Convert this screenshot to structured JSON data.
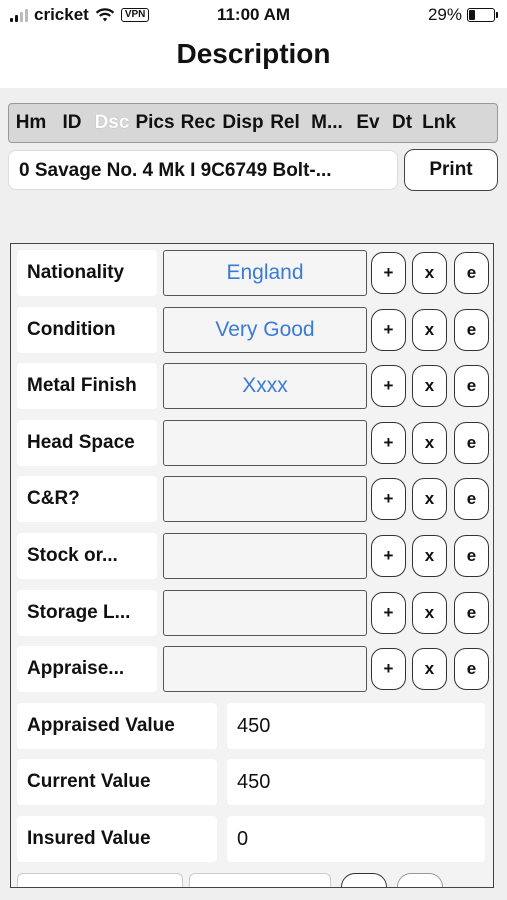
{
  "status": {
    "carrier": "cricket",
    "vpn": "VPN",
    "time": "11:00 AM",
    "battery": "29%",
    "battery_level": 0.29
  },
  "title": "Description",
  "tabs": [
    {
      "label": "Hm"
    },
    {
      "label": "ID"
    },
    {
      "label": "Dsc",
      "active": true
    },
    {
      "label": "Pics"
    },
    {
      "label": "Rec"
    },
    {
      "label": "Disp"
    },
    {
      "label": "Rel"
    },
    {
      "label": "M..."
    },
    {
      "label": "Ev"
    },
    {
      "label": "Dt"
    },
    {
      "label": "Lnk"
    }
  ],
  "record": {
    "title": "0 Savage  No. 4 Mk I 9C6749 Bolt-...",
    "print_label": "Print"
  },
  "fields": [
    {
      "label": "Nationality",
      "value": "England"
    },
    {
      "label": "Condition",
      "value": "Very Good"
    },
    {
      "label": "Metal Finish",
      "value": "Xxxx"
    },
    {
      "label": "Head Space",
      "value": ""
    },
    {
      "label": "C&R?",
      "value": ""
    },
    {
      "label": "Stock or...",
      "value": ""
    },
    {
      "label": "Storage L...",
      "value": ""
    },
    {
      "label": "Appraise...",
      "value": ""
    }
  ],
  "row_buttons": {
    "add": "+",
    "clear": "x",
    "edit": "e"
  },
  "values": [
    {
      "label": "Appraised Value",
      "value": "450"
    },
    {
      "label": "Current Value",
      "value": "450"
    },
    {
      "label": "Insured Value",
      "value": "0"
    }
  ],
  "colors": {
    "link_value": "#3a7bd5",
    "background_gray": "#efefef",
    "tab_bar": "#d7d7d7"
  }
}
